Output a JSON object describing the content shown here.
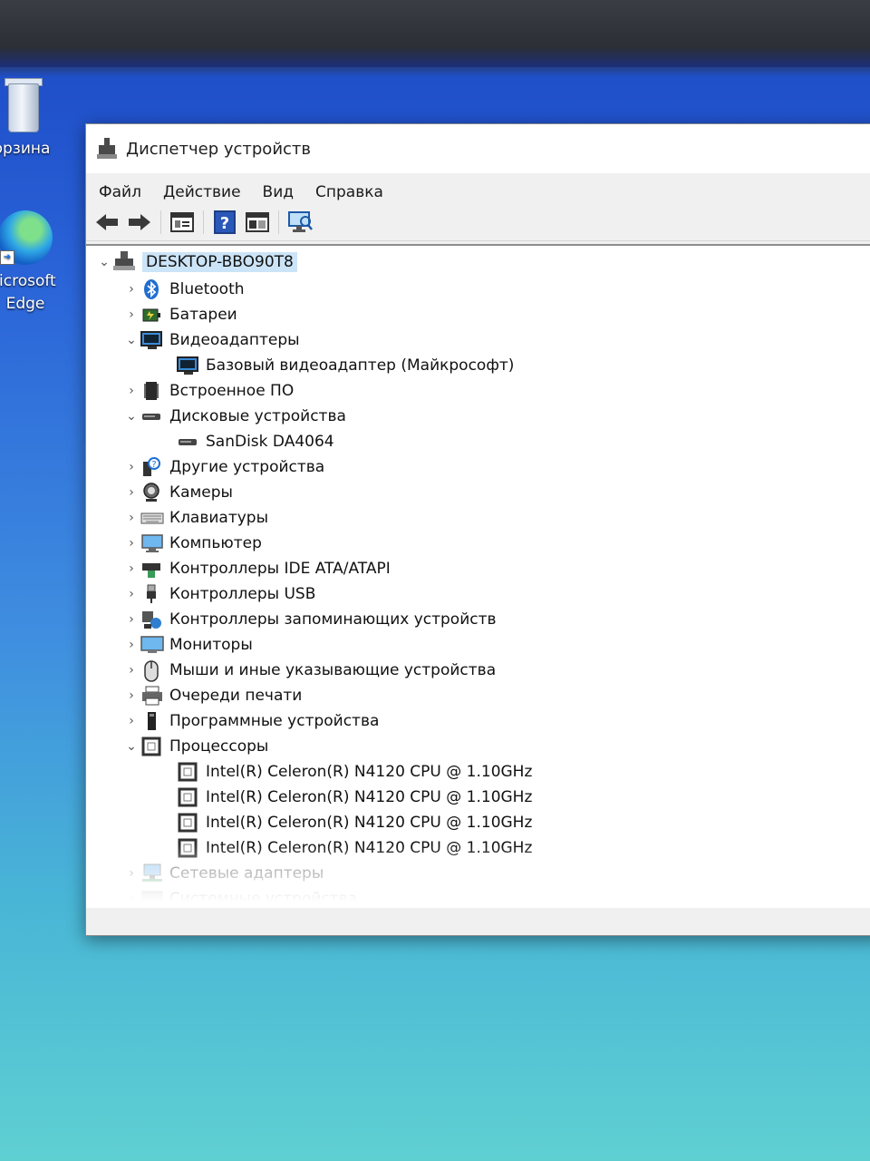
{
  "desktop": {
    "recycle_bin_label": "орзина",
    "edge_label_line1": "licrosoft",
    "edge_label_line2": "Edge"
  },
  "window": {
    "title": "Диспетчер устройств",
    "menu": [
      "Файл",
      "Действие",
      "Вид",
      "Справка"
    ],
    "toolbar_icons": [
      "back-arrow-icon",
      "forward-arrow-icon",
      "properties-window-icon",
      "help-icon",
      "view-icon",
      "monitor-scan-icon"
    ]
  },
  "tree": {
    "root": "DESKTOP-BBO90T8",
    "items": [
      {
        "label": "Bluetooth",
        "level": 1,
        "state": "collapsed",
        "icon": "bluetooth-icon"
      },
      {
        "label": "Батареи",
        "level": 1,
        "state": "collapsed",
        "icon": "battery-icon"
      },
      {
        "label": "Видеоадаптеры",
        "level": 1,
        "state": "expanded",
        "icon": "display-adapter-icon"
      },
      {
        "label": "Базовый видеоадаптер (Майкрософт)",
        "level": 2,
        "state": "leaf",
        "icon": "display-adapter-icon"
      },
      {
        "label": "Встроенное ПО",
        "level": 1,
        "state": "collapsed",
        "icon": "firmware-icon"
      },
      {
        "label": "Дисковые устройства",
        "level": 1,
        "state": "expanded",
        "icon": "disk-drive-icon"
      },
      {
        "label": "SanDisk DA4064",
        "level": 2,
        "state": "leaf",
        "icon": "disk-drive-icon"
      },
      {
        "label": "Другие устройства",
        "level": 1,
        "state": "collapsed",
        "icon": "other-devices-icon"
      },
      {
        "label": "Камеры",
        "level": 1,
        "state": "collapsed",
        "icon": "camera-icon"
      },
      {
        "label": "Клавиатуры",
        "level": 1,
        "state": "collapsed",
        "icon": "keyboard-icon"
      },
      {
        "label": "Компьютер",
        "level": 1,
        "state": "collapsed",
        "icon": "computer-icon"
      },
      {
        "label": "Контроллеры IDE ATA/ATAPI",
        "level": 1,
        "state": "collapsed",
        "icon": "ide-controller-icon"
      },
      {
        "label": "Контроллеры USB",
        "level": 1,
        "state": "collapsed",
        "icon": "usb-icon"
      },
      {
        "label": "Контроллеры запоминающих устройств",
        "level": 1,
        "state": "collapsed",
        "icon": "storage-controller-icon"
      },
      {
        "label": "Мониторы",
        "level": 1,
        "state": "collapsed",
        "icon": "monitor-icon"
      },
      {
        "label": "Мыши и иные указывающие устройства",
        "level": 1,
        "state": "collapsed",
        "icon": "mouse-icon"
      },
      {
        "label": "Очереди печати",
        "level": 1,
        "state": "collapsed",
        "icon": "printer-icon"
      },
      {
        "label": "Программные устройства",
        "level": 1,
        "state": "collapsed",
        "icon": "software-device-icon"
      },
      {
        "label": "Процессоры",
        "level": 1,
        "state": "expanded",
        "icon": "processor-icon"
      },
      {
        "label": "Intel(R) Celeron(R) N4120 CPU @ 1.10GHz",
        "level": 2,
        "state": "leaf",
        "icon": "processor-icon"
      },
      {
        "label": "Intel(R) Celeron(R) N4120 CPU @ 1.10GHz",
        "level": 2,
        "state": "leaf",
        "icon": "processor-icon"
      },
      {
        "label": "Intel(R) Celeron(R) N4120 CPU @ 1.10GHz",
        "level": 2,
        "state": "leaf",
        "icon": "processor-icon"
      },
      {
        "label": "Intel(R) Celeron(R) N4120 CPU @ 1.10GHz",
        "level": 2,
        "state": "leaf",
        "icon": "processor-icon"
      },
      {
        "label": "Сетевые адаптеры",
        "level": 1,
        "state": "collapsed",
        "icon": "network-adapter-icon"
      },
      {
        "label": "Системные устройства",
        "level": 1,
        "state": "collapsed",
        "icon": "system-devices-icon"
      }
    ]
  }
}
